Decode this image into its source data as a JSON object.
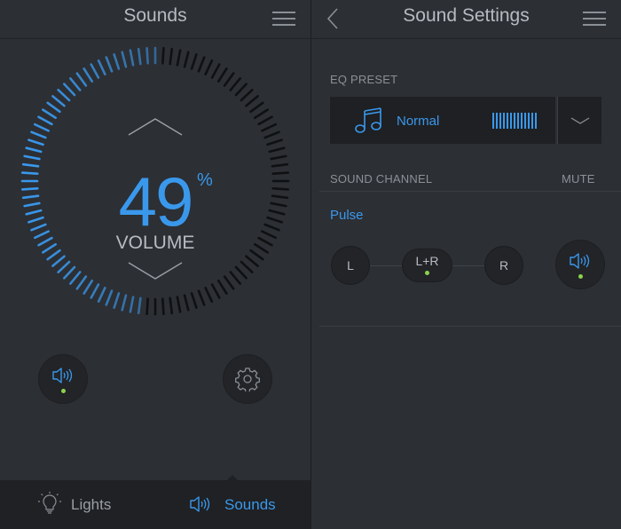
{
  "left": {
    "title": "Sounds",
    "volume": {
      "value": "49",
      "unit": "%",
      "label": "VOLUME",
      "level": 0.49
    },
    "tabs": [
      {
        "label": "Lights",
        "icon": "lightbulb-icon",
        "active": false
      },
      {
        "label": "Sounds",
        "icon": "speaker-icon",
        "active": true
      }
    ],
    "speaker_button_icon": "speaker-icon",
    "settings_button_icon": "gear-icon"
  },
  "right": {
    "title": "Sound Settings",
    "eq": {
      "section_label": "EQ PRESET",
      "preset": "Normal",
      "icon": "music-note-icon"
    },
    "channel": {
      "section_label": "SOUND CHANNEL",
      "mute_label": "MUTE",
      "source": "Pulse",
      "options": [
        "L",
        "L+R",
        "R"
      ],
      "selected": "L+R"
    }
  },
  "colors": {
    "accent": "#3a98ec",
    "indicator": "#8bd34b",
    "inactive_tick": "#0f1012"
  }
}
